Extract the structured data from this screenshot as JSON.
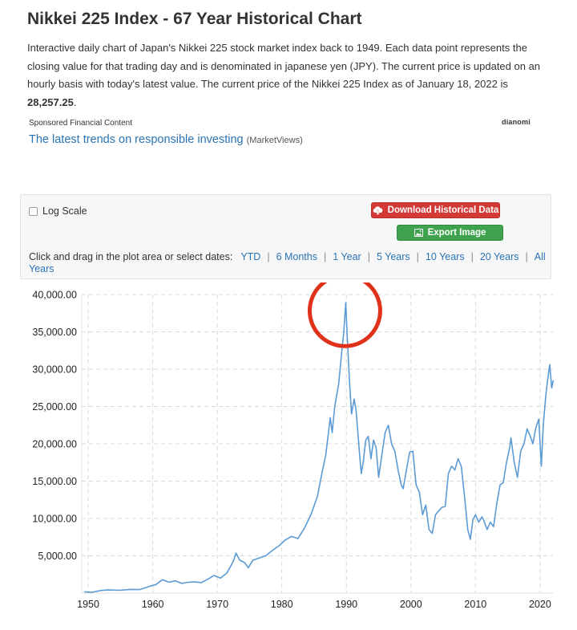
{
  "page": {
    "title": "Nikkei 225 Index - 67 Year Historical Chart",
    "intro_text": "Interactive daily chart of Japan's Nikkei 225 stock market index back to 1949. Each data point represents the closing value for that trading day and is denominated in japanese yen (JPY). The current price is updated on an hourly basis with today's latest value. The current price of the Nikkei 225 Index as of January 18, 2022 is ",
    "current_price": "28,257.25",
    "intro_end": "."
  },
  "sponsored": {
    "label": "Sponsored Financial Content",
    "logo": "dianomi",
    "link_text": "The latest trends on responsible investing",
    "source": "(MarketViews)"
  },
  "controls": {
    "log_scale_label": "Log Scale",
    "download_label": "Download Historical Data",
    "export_label": "Export Image",
    "range_prompt": "Click and drag in the plot area or select dates:",
    "ranges": [
      "YTD",
      "6 Months",
      "1 Year",
      "5 Years",
      "10 Years",
      "20 Years",
      "All Years"
    ]
  },
  "colors": {
    "line": "#5b9bd5",
    "annotation_circle": "#e0311a",
    "link": "#2a73b5",
    "download_button": "#d33a36",
    "export_button": "#3fa34d"
  },
  "icons": {
    "download": "download-cloud-icon",
    "export": "image-icon"
  },
  "chart_data": {
    "type": "line",
    "title": "",
    "xlabel": "",
    "ylabel": "",
    "xlim": [
      1949,
      2022
    ],
    "ylim": [
      0,
      40000
    ],
    "grid": true,
    "legend": "none",
    "x_ticks": [
      1950,
      1960,
      1970,
      1980,
      1990,
      2000,
      2010,
      2020
    ],
    "y_ticks": [
      {
        "value": 5000,
        "label": "5,000.00"
      },
      {
        "value": 10000,
        "label": "10,000.00"
      },
      {
        "value": 15000,
        "label": "15,000.00"
      },
      {
        "value": 20000,
        "label": "20,000.00"
      },
      {
        "value": 25000,
        "label": "25,000.00"
      },
      {
        "value": 30000,
        "label": "30,000.00"
      },
      {
        "value": 35000,
        "label": "35,000.00"
      },
      {
        "value": 40000,
        "label": "40,000.00"
      }
    ],
    "annotation": {
      "type": "circle",
      "year": 1989.9,
      "value": 38900,
      "note": "peak highlight"
    },
    "series": [
      {
        "x": [
          1949.4,
          1950.5,
          1952,
          1953,
          1955,
          1956.5,
          1958,
          1959.5,
          1960.5,
          1961.5,
          1962.5,
          1963.5,
          1964.5,
          1965.5,
          1966.5,
          1967.5,
          1968.5,
          1969.5,
          1970.5,
          1971.5,
          1972.5,
          1972.9,
          1973.5,
          1974.2,
          1974.8,
          1975.5,
          1976.5,
          1977.5,
          1978.5,
          1979.5,
          1980.5,
          1981.5,
          1982.5,
          1983.5,
          1984.5,
          1985.5,
          1986.2,
          1986.8,
          1987.5,
          1987.8,
          1988.2,
          1988.8,
          1989.3,
          1989.6,
          1989.9,
          1990.2,
          1990.5,
          1990.8,
          1991.2,
          1991.5,
          1992.0,
          1992.3,
          1992.6,
          1993.0,
          1993.4,
          1993.8,
          1994.2,
          1994.6,
          1995.0,
          1995.5,
          1996.0,
          1996.5,
          1997.0,
          1997.5,
          1998.0,
          1998.5,
          1998.8,
          1999.3,
          1999.8,
          2000.3,
          2000.8,
          2001.3,
          2001.8,
          2002.3,
          2002.8,
          2003.3,
          2003.8,
          2004.3,
          2004.8,
          2005.3,
          2005.8,
          2006.3,
          2006.8,
          2007.3,
          2007.8,
          2008.3,
          2008.8,
          2009.2,
          2009.6,
          2010.0,
          2010.5,
          2011.0,
          2011.3,
          2011.8,
          2012.3,
          2012.8,
          2013.3,
          2013.8,
          2014.3,
          2014.8,
          2015.3,
          2015.5,
          2016.0,
          2016.5,
          2017.0,
          2017.5,
          2018.0,
          2018.5,
          2018.9,
          2019.3,
          2019.8,
          2020.2,
          2020.5,
          2020.9,
          2021.2,
          2021.5,
          2021.8,
          2022.05
        ],
        "y": [
          176,
          102,
          360,
          420,
          380,
          500,
          470,
          900,
          1150,
          1800,
          1450,
          1650,
          1300,
          1450,
          1500,
          1400,
          1850,
          2350,
          2000,
          2700,
          4300,
          5350,
          4400,
          4100,
          3400,
          4400,
          4700,
          5000,
          5700,
          6300,
          7100,
          7600,
          7300,
          8700,
          10500,
          12900,
          16000,
          18500,
          23500,
          21500,
          25000,
          28000,
          32500,
          35000,
          38900,
          33000,
          28000,
          24000,
          26000,
          24500,
          19000,
          16000,
          17500,
          20500,
          21000,
          18000,
          20500,
          19500,
          15500,
          18500,
          21500,
          22500,
          20000,
          19000,
          16500,
          14500,
          14000,
          16500,
          18900,
          19000,
          14500,
          13500,
          10500,
          11800,
          8500,
          8000,
          10500,
          11000,
          11500,
          11600,
          16000,
          17000,
          16500,
          18000,
          17000,
          13000,
          8500,
          7200,
          9800,
          10500,
          9500,
          10200,
          9700,
          8500,
          9500,
          8900,
          12000,
          14500,
          14800,
          17500,
          19500,
          20800,
          17500,
          15500,
          19000,
          20000,
          22000,
          21000,
          20000,
          22000,
          23300,
          17000,
          22500,
          26500,
          28800,
          30600,
          27500,
          28500
        ]
      }
    ]
  }
}
